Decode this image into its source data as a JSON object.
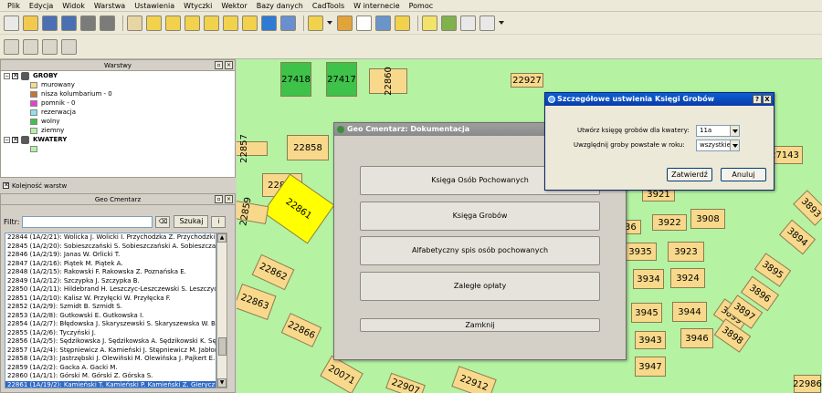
{
  "menubar": [
    "Plik",
    "Edycja",
    "Widok",
    "Warstwa",
    "Ustawienia",
    "Wtyczki",
    "Wektor",
    "Bazy danych",
    "CadTools",
    "W internecie",
    "Pomoc"
  ],
  "toolbar_icons": [
    "new-file-icon",
    "open-icon",
    "save-icon",
    "save-as-icon",
    "print-icon",
    "print-layout-icon",
    "pan-icon",
    "zoom-in-icon",
    "zoom-out-icon",
    "zoom-full-icon",
    "zoom-layer-icon",
    "zoom-selection-icon",
    "zoom-last-icon",
    "refresh-icon",
    "identify-icon",
    "select-icon",
    "deselect-icon",
    "attribute-table-icon",
    "measure-icon",
    "annotation-icon",
    "map-tips-icon",
    "bookmark-icon",
    "field-calc-icon",
    "label-icon"
  ],
  "toolbar2_icons": [
    "digitize-icon",
    "node-tool-icon",
    "edit-tool-icon",
    "snap-tool-icon"
  ],
  "layers_panel": {
    "title": "Warstwy",
    "groups": [
      {
        "name": "GROBY",
        "children": [
          {
            "label": "murowany",
            "color": "#f8d98b"
          },
          {
            "label": "nisza kolumbarium - 0",
            "color": "#c0792d"
          },
          {
            "label": "pomnik - 0",
            "color": "#e83fd0"
          },
          {
            "label": "rezerwacja",
            "color": "#8fe3e8"
          },
          {
            "label": "wolny",
            "color": "#3ec24a"
          },
          {
            "label": "ziemny",
            "color": "#b5f2a2"
          }
        ]
      },
      {
        "name": "KWATERY",
        "children": [
          {
            "label": "",
            "color": "#b5f2a2"
          }
        ]
      }
    ]
  },
  "layer_order_label": "Kolejność warstw",
  "geo_panel": {
    "title": "Geo Cmentarz",
    "filter_label": "Filtr:",
    "filter_value": "",
    "search_label": "Szukaj",
    "records": [
      "22844 (1A/2/21): Wolicka J. Wolicki I. Przychodzka Z. Przychodzki J. W",
      "22845 (1A/2/20): Sobieszczański S. Sobieszczański A. Sobieszczański W",
      "22846 (1A/2/19): Janas W. Orlicki T.",
      "22847 (1A/2/16): Piątek M. Piątek A.",
      "22848 (1A/2/15): Rakowski F. Rakowska Z. Poznańska E.",
      "22849 (1A/2/12): Szczypka J. Szczypka B.",
      "22850 (1A/2/11): Hildebrand H. Leszczyc-Leszczewski S. Leszczyc-Lesz",
      "22851 (1A/2/10): Kalisz W. Przyłęcki W. Przyłęcka F.",
      "22852 (1A/2/9): Szmidt B. Szmidt S.",
      "22853 (1A/2/8): Gutkowski E. Gutkowska I.",
      "22854 (1A/2/7): Błędowska J. Skaryszewski S. Skaryszewska W. Błędo",
      "22855 (1A/2/6): Tyczyński J.",
      "22856 (1A/2/5): Sędzikowska J. Sędzikowska A. Sędzikowski K. Sędziko",
      "22857 (1A/2/4): Stępniewicz A. Kamieński J. Stępniewicz M. Jabłoński T",
      "22858 (1A/2/3): Jastrzębski J. Olewiński M. Olewińska J. Pajkert E. Pa",
      "22859 (1A/2/2): Gacka A. Gacki M.",
      "22860 (1A/1/1): Górski M. Górski Z. Górska S.",
      "22861 (1A/19/2): Kamieński T. Kamieński P. Kamieński Z. Gierycz M. Gie"
    ],
    "selected_index": 17
  },
  "map": {
    "plots": [
      {
        "label": "27418",
        "style": "dark"
      },
      {
        "label": "27417",
        "style": "dark"
      },
      {
        "label": "22860",
        "style": "normal"
      },
      {
        "label": "22927",
        "style": "normal"
      },
      {
        "label": "22857",
        "style": "normal"
      },
      {
        "label": "22858",
        "style": "normal"
      },
      {
        "label": "22868",
        "style": "normal"
      },
      {
        "label": "22861",
        "style": "yellow"
      },
      {
        "label": "22859",
        "style": "normal"
      },
      {
        "label": "22862",
        "style": "normal"
      },
      {
        "label": "22863",
        "style": "normal"
      },
      {
        "label": "22866",
        "style": "normal"
      },
      {
        "label": "20071",
        "style": "normal"
      },
      {
        "label": "22912",
        "style": "normal"
      },
      {
        "label": "22907",
        "style": "normal"
      },
      {
        "label": "3921",
        "style": "normal"
      },
      {
        "label": "3922",
        "style": "normal"
      },
      {
        "label": "3908",
        "style": "normal"
      },
      {
        "label": "3936",
        "style": "normal"
      },
      {
        "label": "3935",
        "style": "normal"
      },
      {
        "label": "3923",
        "style": "normal"
      },
      {
        "label": "3934",
        "style": "normal"
      },
      {
        "label": "3924",
        "style": "normal"
      },
      {
        "label": "3945",
        "style": "normal"
      },
      {
        "label": "3944",
        "style": "normal"
      },
      {
        "label": "3943",
        "style": "normal"
      },
      {
        "label": "3946",
        "style": "normal"
      },
      {
        "label": "3947",
        "style": "normal"
      },
      {
        "label": "3899",
        "style": "normal"
      },
      {
        "label": "3898",
        "style": "normal"
      },
      {
        "label": "3897",
        "style": "normal"
      },
      {
        "label": "3896",
        "style": "normal"
      },
      {
        "label": "3895",
        "style": "normal"
      },
      {
        "label": "3894",
        "style": "normal"
      },
      {
        "label": "3893",
        "style": "normal"
      },
      {
        "label": "27143",
        "style": "normal"
      },
      {
        "label": "22986",
        "style": "normal"
      }
    ]
  },
  "doc_dialog": {
    "title": "Geo Cmentarz: Dokumentacja",
    "buttons": [
      "Księga Osób Pochowanych",
      "Księga Grobów",
      "Alfabetyczny spis osób pochowanych",
      "Zaległe opłaty"
    ],
    "close_label": "Zamknij"
  },
  "settings_dialog": {
    "title": "Szczegółowe ustwienia Księgi Grobów",
    "kwatera_label": "Utwórz księgę grobów dla kwatery:",
    "kwatera_value": "11a",
    "rok_label": "Uwzględnij groby powstałe w roku:",
    "rok_value": "wszystkie",
    "ok_label": "Zatwierdź",
    "cancel_label": "Anuluj",
    "help_label": "?",
    "close_label": "X"
  },
  "colors": {
    "map_bg": "#b5f2a2",
    "plot": "#f8d98b",
    "free_plot": "#3ec24a",
    "selected_plot": "#ffff00",
    "title_active": "#0a3ca8"
  }
}
